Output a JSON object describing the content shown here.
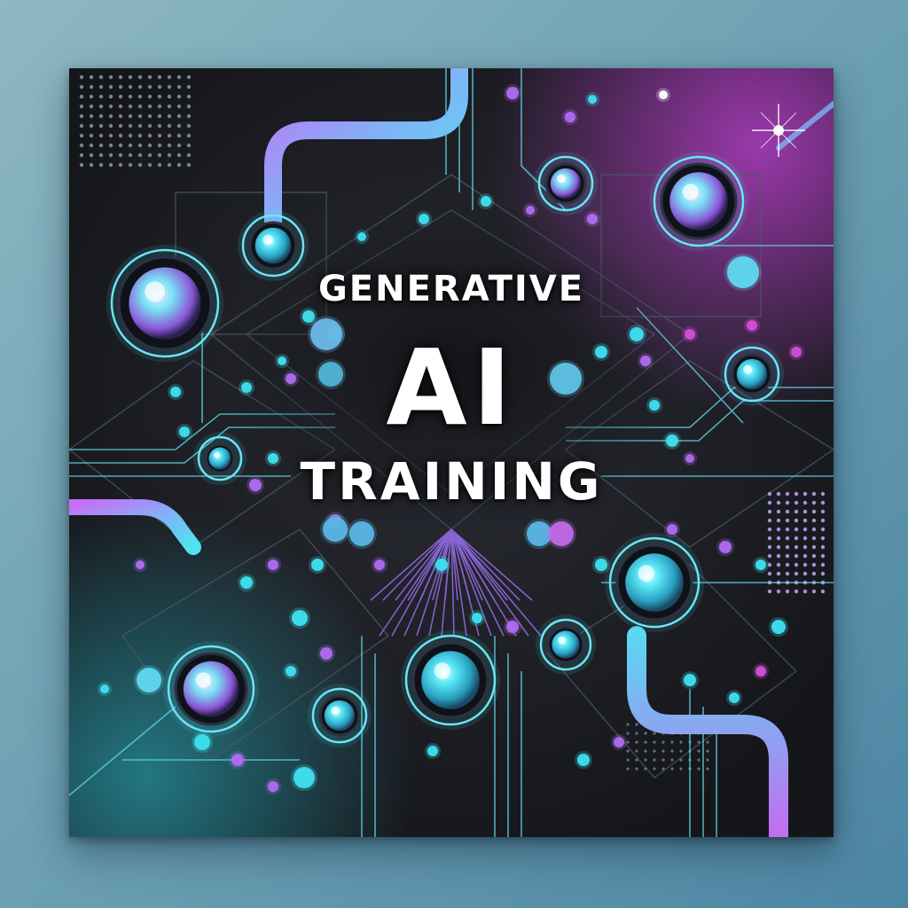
{
  "poster": {
    "line1": "GENERATIVE",
    "line2": "AI",
    "line3": "TRAINING"
  },
  "palette": {
    "background": "#1a1b20",
    "cyan": "#3fe0f0",
    "violet": "#b06cf2",
    "magenta": "#d24fd8",
    "page_backdrop": "#6fa2b4"
  },
  "icons": [
    "node-icon",
    "circuit-trace",
    "dot-grid"
  ]
}
